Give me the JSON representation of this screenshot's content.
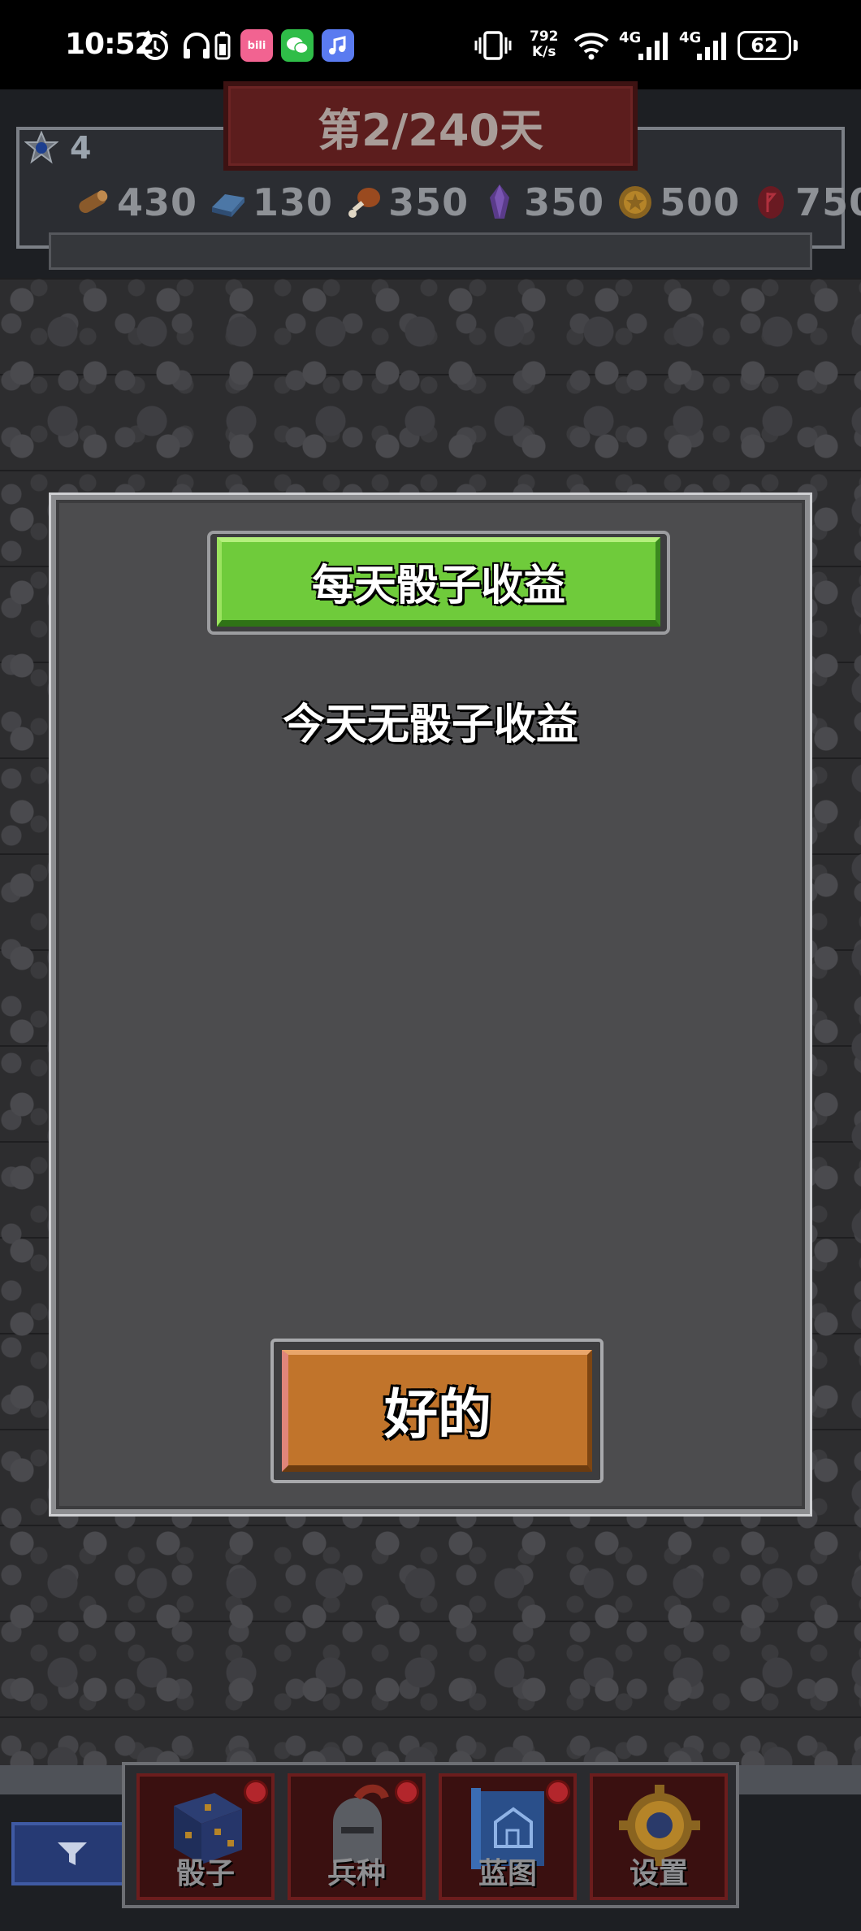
{
  "status_bar": {
    "time": "10:52",
    "speed_value": "792",
    "speed_unit": "K/s",
    "net1": "4G",
    "net2": "4G",
    "battery": "62"
  },
  "header": {
    "day_banner": "第2/240天",
    "level": "4",
    "resources": [
      {
        "icon": "wood-log-icon",
        "value": "430"
      },
      {
        "icon": "iron-bar-icon",
        "value": "130"
      },
      {
        "icon": "meat-icon",
        "value": "350"
      },
      {
        "icon": "purple-crystal-icon",
        "value": "350"
      },
      {
        "icon": "gold-coin-icon",
        "value": "500"
      },
      {
        "icon": "red-rune-icon",
        "value": "750"
      }
    ]
  },
  "dialog": {
    "title": "每天骰子收益",
    "message": "今天无骰子收益",
    "ok_label": "好的"
  },
  "bottom_nav": {
    "items": [
      {
        "label": "骰子",
        "icon": "dice-icon"
      },
      {
        "label": "兵种",
        "icon": "knight-helmet-icon"
      },
      {
        "label": "蓝图",
        "icon": "blueprint-icon"
      },
      {
        "label": "设置",
        "icon": "gear-icon"
      }
    ]
  },
  "colors": {
    "title_button": "#6fcb3b",
    "ok_button": "#c1742b",
    "day_banner": "#5c1d1d",
    "notification_dot": "#b3262c"
  }
}
